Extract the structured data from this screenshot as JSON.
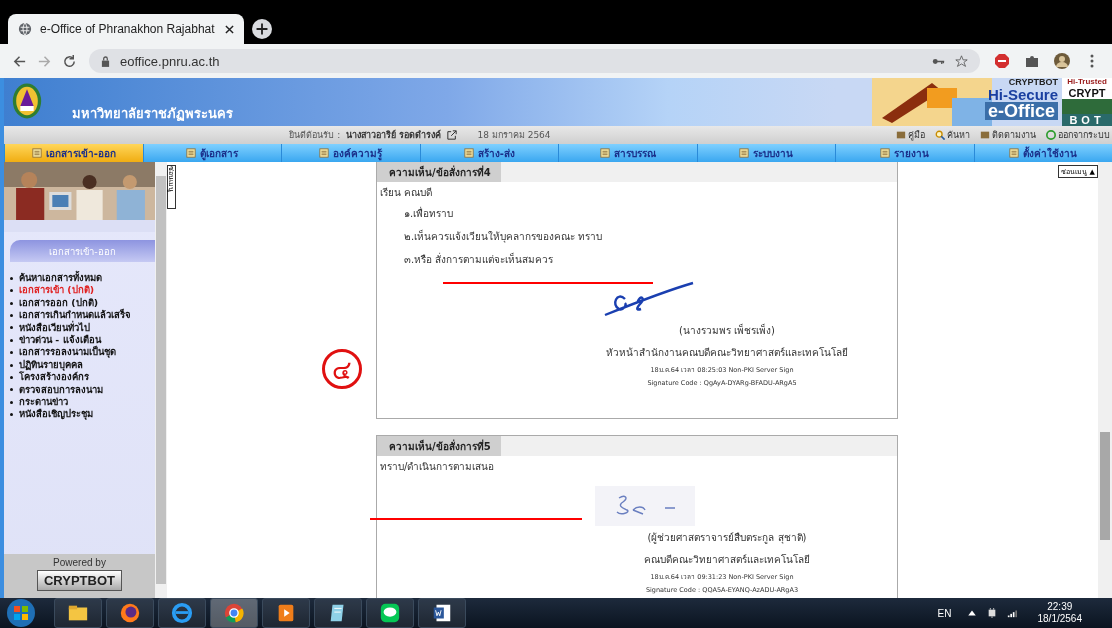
{
  "browser": {
    "tab_title": "e-Office of Phranakhon Rajabhat",
    "url": "eoffice.pnru.ac.th"
  },
  "banner": {
    "university": "มหาวิทยาลัยราชภัฏพระนคร",
    "logo_top": "CRYPTBOT",
    "logo_mid": "Hi-Secure",
    "logo_main": "e-Office",
    "badge_top": "Hi-Trusted",
    "badge_mid": "CRYPT",
    "badge_bottom": "BOT"
  },
  "welcome": {
    "label": "ยินดีต้อนรับ :",
    "user": "นางสาวอาริย์ รอดดำรงค์",
    "date": "18 มกราคม 2564",
    "links": [
      "คู่มือ",
      "ค้นหา",
      "ติดตามงาน",
      "ออกจากระบบ"
    ]
  },
  "nav": [
    {
      "label": "เอกสารเข้า-ออก",
      "selected": true
    },
    {
      "label": "ตู้เอกสาร",
      "selected": false
    },
    {
      "label": "องค์ความรู้",
      "selected": false
    },
    {
      "label": "สร้าง-ส่ง",
      "selected": false
    },
    {
      "label": "สารบรรณ",
      "selected": false
    },
    {
      "label": "ระบบงาน",
      "selected": false
    },
    {
      "label": "รายงาน",
      "selected": false
    },
    {
      "label": "ตั้งค่าใช้งาน",
      "selected": false
    }
  ],
  "sidebar": {
    "heading": "เอกสารเข้า-ออก",
    "items": [
      {
        "label": "ค้นหาเอกสารทั้งหมด",
        "selected": false
      },
      {
        "label": "เอกสารเข้า (ปกติ)",
        "selected": true
      },
      {
        "label": "เอกสารออก (ปกติ)",
        "selected": false
      },
      {
        "label": "เอกสารเกินกำหนดแล้วเสร็จ",
        "selected": false
      },
      {
        "label": "หนังสือเวียนทั่วไป",
        "selected": false
      },
      {
        "label": "ข่าวด่วน - แจ้งเตือน",
        "selected": false
      },
      {
        "label": "เอกสารรอลงนามเป็นชุด",
        "selected": false
      },
      {
        "label": "ปฏิทินรายบุคคล",
        "selected": false
      },
      {
        "label": "โครงสร้างองค์กร",
        "selected": false
      },
      {
        "label": "ตรวจสอบการลงนาม",
        "selected": false
      },
      {
        "label": "กระดานข่าว",
        "selected": false
      },
      {
        "label": "หนังสือเชิญประชุม",
        "selected": false
      }
    ],
    "powered_by": "Powered by",
    "powered_logo": "CRYPTBOT",
    "hide_menu": "ซ่อนเมนู"
  },
  "content": {
    "hide_menu": "ซ่อนเมนู ▲",
    "annotation": "๔",
    "opinions": [
      {
        "title": "ความเห็น/ข้อสั่งการที่4",
        "lines": [
          "เรียน  คณบดี",
          "๑.เพื่อทราบ",
          "๒.เห็นควรแจ้งเวียนให้บุคลากรของคณะ ทราบ",
          "๓.หรือ สั่งการตามแต่จะเห็นสมควร"
        ],
        "signer": "(นางรวมพร เพ็ชรเพ็ง)",
        "position": "หัวหน้าสำนักงานคณบดีคณะวิทยาศาสตร์และเทคโนโลยี",
        "signed_at": "18ม.ค.64 เวลา 08:25:03  Non-PKI Server Sign",
        "signature_code": "Signature Code : QgAyA-DYARg-BFADU-ARgA5"
      },
      {
        "title": "ความเห็น/ข้อสั่งการที่5",
        "lines": [
          "ทราบ/ดำเนินการตามเสนอ"
        ],
        "signer": "(ผู้ช่วยศาสตราจารย์สืบตระกูล สุชาติ)",
        "position": "คณบดีคณะวิทยาศาสตร์และเทคโนโลยี",
        "signed_at": "18ม.ค.64 เวลา 09:31:23  Non-PKI Server Sign",
        "signature_code": "Signature Code : QQA5A-EYANQ-AzADU-ARgA3"
      }
    ]
  },
  "taskbar": {
    "language": "EN",
    "time": "22:39",
    "date": "18/1/2564"
  }
}
